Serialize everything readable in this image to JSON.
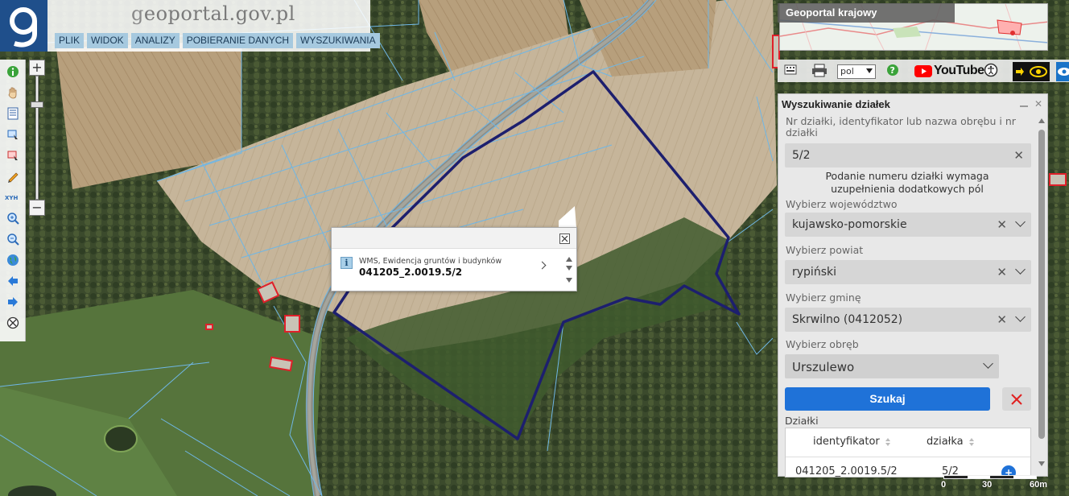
{
  "header": {
    "site_title_pre": "g",
    "site_title_rest": "eoportal.gov.pl",
    "menu": [
      "PLIK",
      "WIDOK",
      "ANALIZY",
      "POBIERANIE DANYCH",
      "WYSZUKIWANIA"
    ]
  },
  "overview": {
    "label": "Geoportal krajowy"
  },
  "top_tools": {
    "language": "pol",
    "youtube": "YouTube"
  },
  "popup": {
    "source": "WMS, Ewidencja gruntów i budynków",
    "parcel_id": "041205_2.0019.5/2",
    "info_icon": "i"
  },
  "panel": {
    "title": "Wyszukiwanie działek",
    "parcel_label": "Nr działki, identyfikator lub nazwa obrębu i nr działki",
    "parcel_value": "5/2",
    "note": "Podanie numeru działki wymaga uzupełnienia dodatkowych pól",
    "voivodeship_label": "Wybierz województwo",
    "voivodeship_value": "kujawsko-pomorskie",
    "county_label": "Wybierz powiat",
    "county_value": "rypiński",
    "commune_label": "Wybierz gminę",
    "commune_value": "Skrwilno (0412052)",
    "precinct_label": "Wybierz obręb",
    "precinct_value": "Urszulewo",
    "search_label": "Szukaj",
    "results_label": "Działki",
    "columns": [
      "identyfikator",
      "działka"
    ],
    "rows": [
      {
        "identyfikator": "041205_2.0019.5/2",
        "dzialka": "5/2"
      }
    ]
  },
  "scale": {
    "labels": [
      "0",
      "30",
      "60m"
    ]
  },
  "colors": {
    "accent": "#1f72d8",
    "logo_bg": "#1f4f8b",
    "menu_bg": "#a6c9df",
    "parcel_outline": "#1d1f6e",
    "boundary_lines": "#6fb7e6",
    "building_outline": "#e0202a"
  }
}
